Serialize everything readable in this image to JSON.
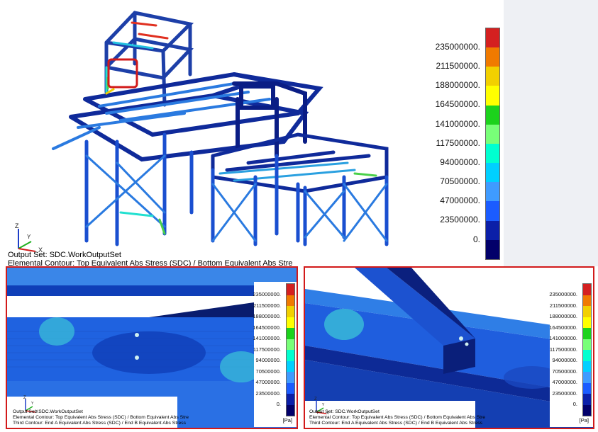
{
  "main": {
    "legend": {
      "colors": [
        "#d42020",
        "#f07a00",
        "#f2d000",
        "#ffff00",
        "#1cd21c",
        "#78ff78",
        "#00ffd0",
        "#00d0ff",
        "#3f9bff",
        "#1b5cff",
        "#0b1fa8",
        "#02006a"
      ],
      "labels": [
        "235000000.",
        "211500000.",
        "188000000.",
        "164500000.",
        "141000000.",
        "117500000.",
        "94000000.",
        "70500000.",
        "47000000.",
        "23500000.",
        "0."
      ]
    },
    "output_set": "Output Set: SDC.WorkOutputSet",
    "contour": "Elemental Contour: Top Equivalent Abs Stress (SDC) / Bottom Equivalent Abs Stre",
    "axis": {
      "z": "Z",
      "y": "Y",
      "x": "X"
    }
  },
  "detail_left": {
    "labels": [
      "235000000.",
      "211500000.",
      "188000000.",
      "164500000.",
      "141000000.",
      "117500000.",
      "94000000.",
      "70500000.",
      "47000000.",
      "23500000.",
      "0."
    ],
    "unit": "[Pa]",
    "output_set": "Output Set: SDC.WorkOutputSet",
    "contour1": "Elemental Contour: Top Equivalent Abs Stress (SDC) / Bottom Equivalent Abs Stre",
    "contour2": "Third Contour: End A Equivalent Abs Stress (SDC) / End B Equivalent Abs Stress",
    "axis": {
      "z": "Z",
      "y": "Y",
      "x": "X"
    }
  },
  "detail_right": {
    "labels": [
      "235000000.",
      "211500000.",
      "188000000.",
      "164500000.",
      "141000000.",
      "117500000.",
      "94000000.",
      "70500000.",
      "47000000.",
      "23500000.",
      "0."
    ],
    "unit": "[Pa]",
    "output_set": "Output Set: SDC.WorkOutputSet",
    "contour1": "Elemental Contour: Top Equivalent Abs Stress (SDC) / Bottom Equivalent Abs Stre",
    "contour2": "Third Contour: End A Equivalent Abs Stress (SDC) / End B Equivalent Abs Stress",
    "axis": {
      "z": "Z",
      "y": "Y",
      "x": "X"
    }
  }
}
